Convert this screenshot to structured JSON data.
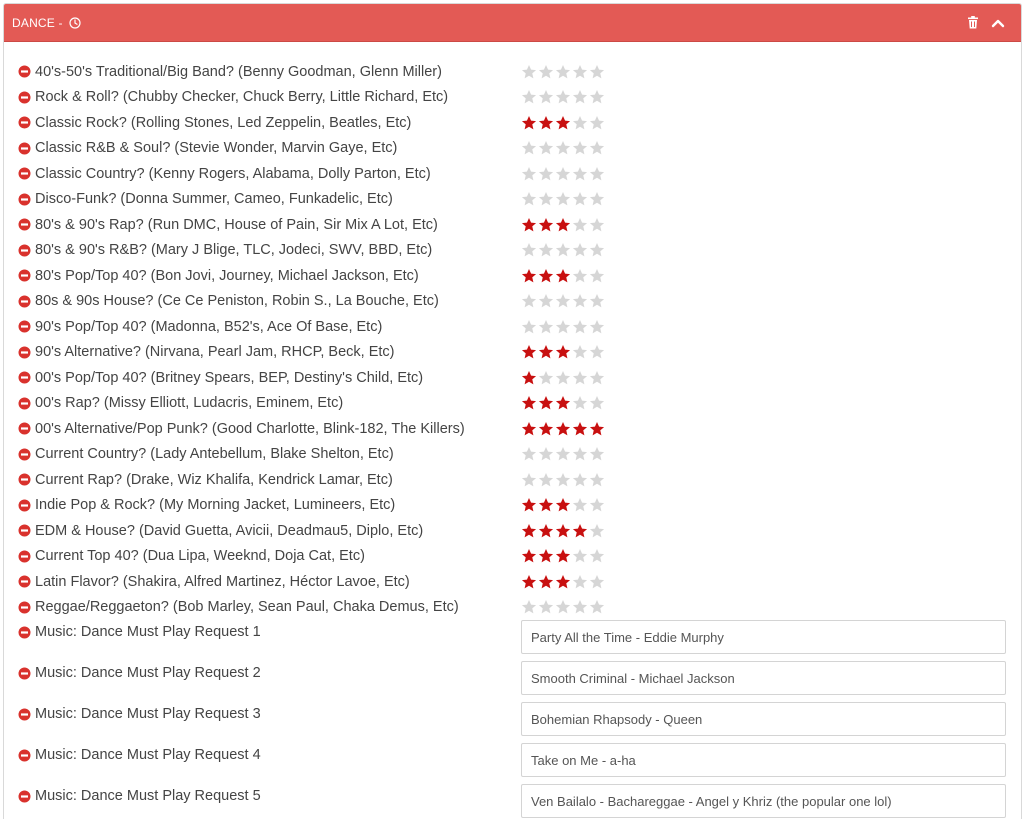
{
  "header": {
    "title": "DANCE -",
    "bg_color": "#e35a55"
  },
  "colors": {
    "star_on": "#c81010",
    "star_off": "#d6d6d6",
    "remove": "#d9322d"
  },
  "questions": [
    {
      "label": "40's-50's Traditional/Big Band? (Benny Goodman, Glenn Miller)",
      "rating": 0
    },
    {
      "label": "Rock & Roll? (Chubby Checker, Chuck Berry, Little Richard, Etc)",
      "rating": 0
    },
    {
      "label": "Classic Rock? (Rolling Stones, Led Zeppelin, Beatles, Etc)",
      "rating": 3
    },
    {
      "label": "Classic R&B & Soul? (Stevie Wonder, Marvin Gaye, Etc)",
      "rating": 0
    },
    {
      "label": "Classic Country? (Kenny Rogers, Alabama, Dolly Parton, Etc)",
      "rating": 0
    },
    {
      "label": "Disco-Funk? (Donna Summer, Cameo, Funkadelic, Etc)",
      "rating": 0
    },
    {
      "label": "80's & 90's Rap? (Run DMC, House of Pain, Sir Mix A Lot, Etc)",
      "rating": 3
    },
    {
      "label": "80's & 90's R&B? (Mary J Blige, TLC, Jodeci, SWV, BBD, Etc)",
      "rating": 0
    },
    {
      "label": "80's Pop/Top 40? (Bon Jovi, Journey, Michael Jackson, Etc)",
      "rating": 3
    },
    {
      "label": "80s & 90s House? (Ce Ce Peniston, Robin S., La Bouche, Etc)",
      "rating": 0
    },
    {
      "label": "90's Pop/Top 40? (Madonna, B52's, Ace Of Base, Etc)",
      "rating": 0
    },
    {
      "label": "90's Alternative? (Nirvana, Pearl Jam, RHCP, Beck, Etc)",
      "rating": 3
    },
    {
      "label": "00's Pop/Top 40? (Britney Spears, BEP, Destiny's Child, Etc)",
      "rating": 1
    },
    {
      "label": "00's Rap? (Missy Elliott, Ludacris, Eminem, Etc)",
      "rating": 3
    },
    {
      "label": "00's Alternative/Pop Punk? (Good Charlotte, Blink-182, The Killers)",
      "rating": 5
    },
    {
      "label": "Current Country? (Lady Antebellum, Blake Shelton, Etc)",
      "rating": 0
    },
    {
      "label": "Current Rap? (Drake, Wiz Khalifa, Kendrick Lamar, Etc)",
      "rating": 0
    },
    {
      "label": "Indie Pop & Rock? (My Morning Jacket, Lumineers, Etc)",
      "rating": 3
    },
    {
      "label": "EDM & House? (David Guetta, Avicii, Deadmau5, Diplo, Etc)",
      "rating": 4
    },
    {
      "label": "Current Top 40? (Dua Lipa, Weeknd, Doja Cat, Etc)",
      "rating": 3
    },
    {
      "label": "Latin Flavor? (Shakira, Alfred Martinez, Héctor Lavoe, Etc)",
      "rating": 3
    },
    {
      "label": "Reggae/Reggaeton? (Bob Marley, Sean Paul, Chaka Demus, Etc)",
      "rating": 0
    }
  ],
  "requests": [
    {
      "label": "Music: Dance Must Play Request 1",
      "value": "Party All the Time - Eddie Murphy"
    },
    {
      "label": "Music: Dance Must Play Request 2",
      "value": "Smooth Criminal - Michael Jackson"
    },
    {
      "label": "Music: Dance Must Play Request 3",
      "value": "Bohemian Rhapsody - Queen"
    },
    {
      "label": "Music: Dance Must Play Request 4",
      "value": "Take on Me - a-ha"
    },
    {
      "label": "Music: Dance Must Play Request 5",
      "value": "Ven Bailalo - Bachareggae - Angel y Khriz (the popular one lol)"
    }
  ]
}
